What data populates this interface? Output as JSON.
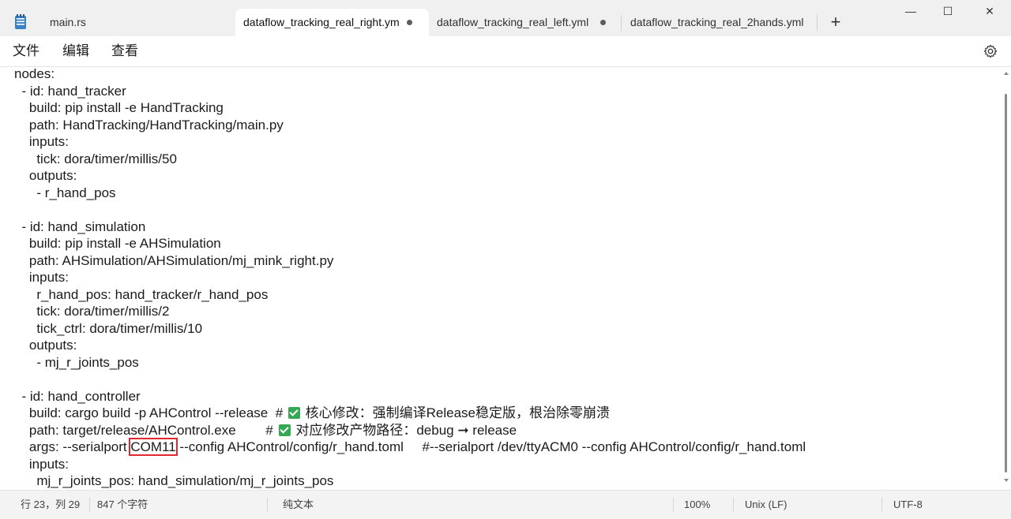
{
  "tabs": [
    {
      "label": "main.rs",
      "active": false,
      "modified": false
    },
    {
      "label": "dataflow_tracking_real_right.ym",
      "active": true,
      "modified": true
    },
    {
      "label": "dataflow_tracking_real_left.yml",
      "active": false,
      "modified": true
    },
    {
      "label": "dataflow_tracking_real_2hands.yml",
      "active": false,
      "modified": false
    }
  ],
  "window_controls": {
    "minimize": "—",
    "maximize": "☐",
    "close": "✕"
  },
  "menu": {
    "file": "文件",
    "edit": "编辑",
    "view": "查看"
  },
  "editor": {
    "lines": [
      "nodes:",
      "  - id: hand_tracker",
      "    build: pip install -e HandTracking",
      "    path: HandTracking/HandTracking/main.py",
      "    inputs:",
      "      tick: dora/timer/millis/50",
      "    outputs:",
      "      - r_hand_pos",
      "",
      "  - id: hand_simulation",
      "    build: pip install -e AHSimulation",
      "    path: AHSimulation/AHSimulation/mj_mink_right.py",
      "    inputs:",
      "      r_hand_pos: hand_tracker/r_hand_pos",
      "      tick: dora/timer/millis/2",
      "      tick_ctrl: dora/timer/millis/10",
      "    outputs:",
      "      - mj_r_joints_pos",
      "",
      "  - id: hand_controller"
    ],
    "line_build": {
      "before": "    build: cargo build -p AHControl --release  # ",
      "after": " 核心修改：强制编译Release稳定版，根治除零崩溃"
    },
    "line_path": {
      "before": "    path: target/release/AHControl.exe        # ",
      "after": " 对应修改产物路径：debug ➞ release"
    },
    "line_args": {
      "before": "    args: --serialport ",
      "highlight": "COM11",
      "after": " --config AHControl/config/r_hand.toml     #--serialport /dev/ttyACM0 --config AHControl/config/r_hand.toml"
    },
    "tail_lines": [
      "    inputs:",
      "      mj_r_joints_pos: hand_simulation/mj_r_joints_pos"
    ]
  },
  "status": {
    "position": "行 23，列 29",
    "chars": "847 个字符",
    "format": "纯文本",
    "zoom": "100%",
    "line_ending": "Unix (LF)",
    "encoding": "UTF-8"
  },
  "colors": {
    "highlight_box": "#e0282e",
    "check": "#34a853",
    "active_tab": "#ffffff"
  }
}
